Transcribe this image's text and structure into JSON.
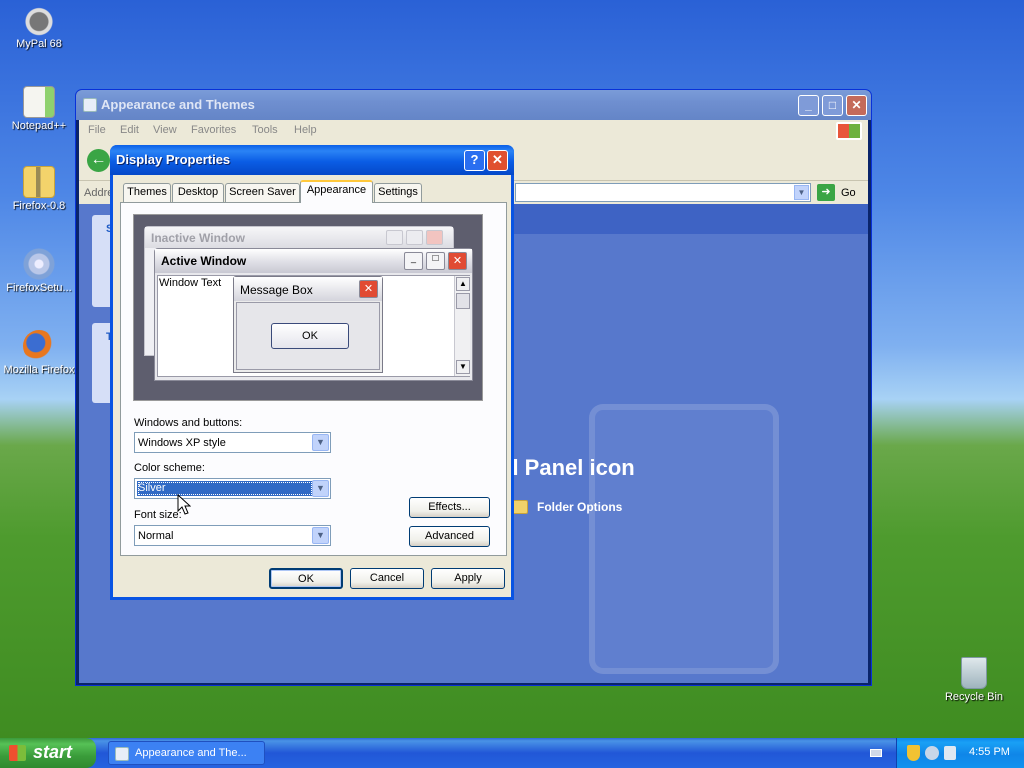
{
  "desktop": {
    "icons": [
      {
        "label": "MyPal 68",
        "icon": "raccoon-icon"
      },
      {
        "label": "Notepad++",
        "icon": "notepad-icon"
      },
      {
        "label": "Firefox-0.8",
        "icon": "zip-folder-icon"
      },
      {
        "label": "FirefoxSetu...",
        "icon": "setup-cd-icon"
      },
      {
        "label": "Mozilla Firefox",
        "icon": "firefox-icon"
      },
      {
        "label": "Recycle Bin",
        "icon": "recycle-bin-icon"
      }
    ]
  },
  "explorer": {
    "title": "Appearance and Themes",
    "menu": [
      "File",
      "Edit",
      "View",
      "Favorites",
      "Tools",
      "Help"
    ],
    "address_label": "Addre",
    "go_label": "Go",
    "body_heading": "ol Panel icon",
    "folder_options": "Folder Options",
    "left_panel_letters": [
      "S",
      "T"
    ]
  },
  "dialog": {
    "title": "Display Properties",
    "help_label": "?",
    "close_label": "✕",
    "tabs": [
      "Themes",
      "Desktop",
      "Screen Saver",
      "Appearance",
      "Settings"
    ],
    "active_tab": "Appearance",
    "preview": {
      "inactive_title": "Inactive Window",
      "active_title": "Active Window",
      "window_text": "Window Text",
      "message_title": "Message Box",
      "ok": "OK"
    },
    "windows_buttons_label": "Windows and buttons:",
    "windows_buttons_value": "Windows XP style",
    "color_scheme_label": "Color scheme:",
    "color_scheme_value": "Silver",
    "font_size_label": "Font size:",
    "font_size_value": "Normal",
    "effects_button": "Effects...",
    "advanced_button": "Advanced",
    "ok_button": "OK",
    "cancel_button": "Cancel",
    "apply_button": "Apply"
  },
  "taskbar": {
    "start_label": "start",
    "task_label": "Appearance and The...",
    "clock": "4:55 PM"
  },
  "colors": {
    "xp_blue": "#0854e3",
    "dialog_bg": "#ece9d8",
    "start_green": "#3a9c3a",
    "highlight": "#316ac5"
  }
}
